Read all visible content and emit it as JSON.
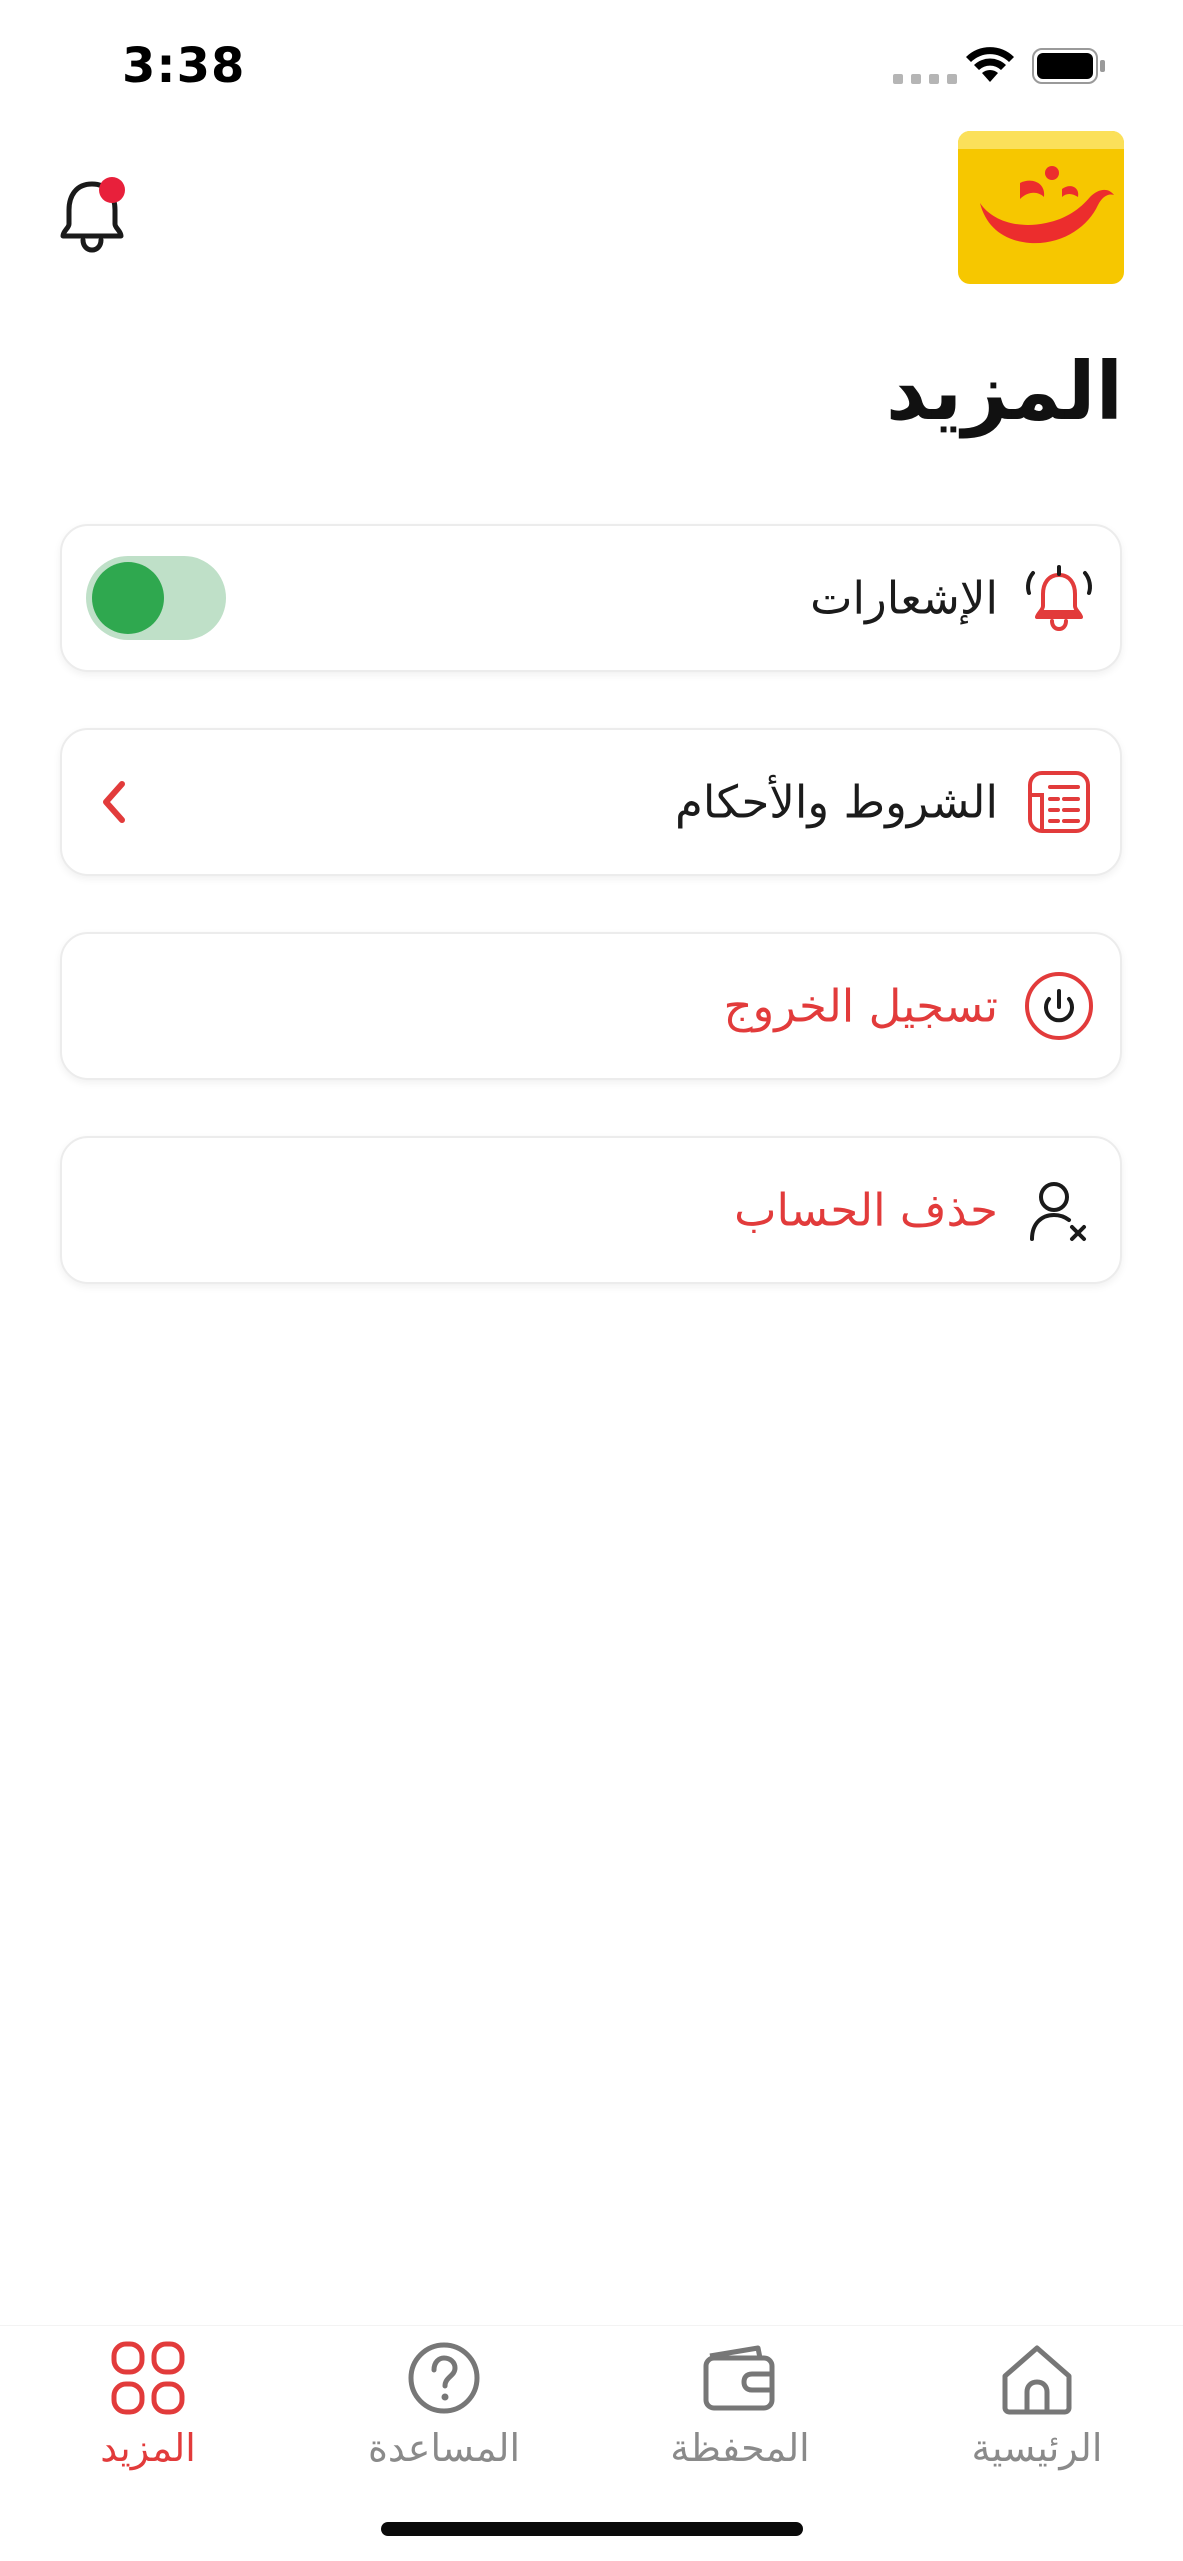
{
  "status_bar": {
    "time": "3:38"
  },
  "header": {
    "title": "المزيد"
  },
  "menu": {
    "notifications": {
      "label": "الإشعارات",
      "enabled": true
    },
    "terms": {
      "label": "الشروط والأحكام"
    },
    "logout": {
      "label": "تسجيل الخروج"
    },
    "delete_account": {
      "label": "حذف الحساب"
    }
  },
  "bottom_nav": {
    "home": "الرئيسية",
    "wallet": "المحفظة",
    "help": "المساعدة",
    "more": "المزيد"
  },
  "colors": {
    "accent": "#e23b3b",
    "toggle_on": "#2fa84f",
    "toggle_track": "#bfe0c8",
    "logo_bg": "#f6c700"
  },
  "icons": {
    "header_bell": "bell-with-badge-icon",
    "notifications": "bell-ringing-icon",
    "terms": "document-list-icon",
    "logout": "power-icon",
    "delete_account": "user-remove-icon",
    "nav_home": "home-icon",
    "nav_wallet": "wallet-icon",
    "nav_help": "question-circle-icon",
    "nav_more": "grid-icon"
  }
}
